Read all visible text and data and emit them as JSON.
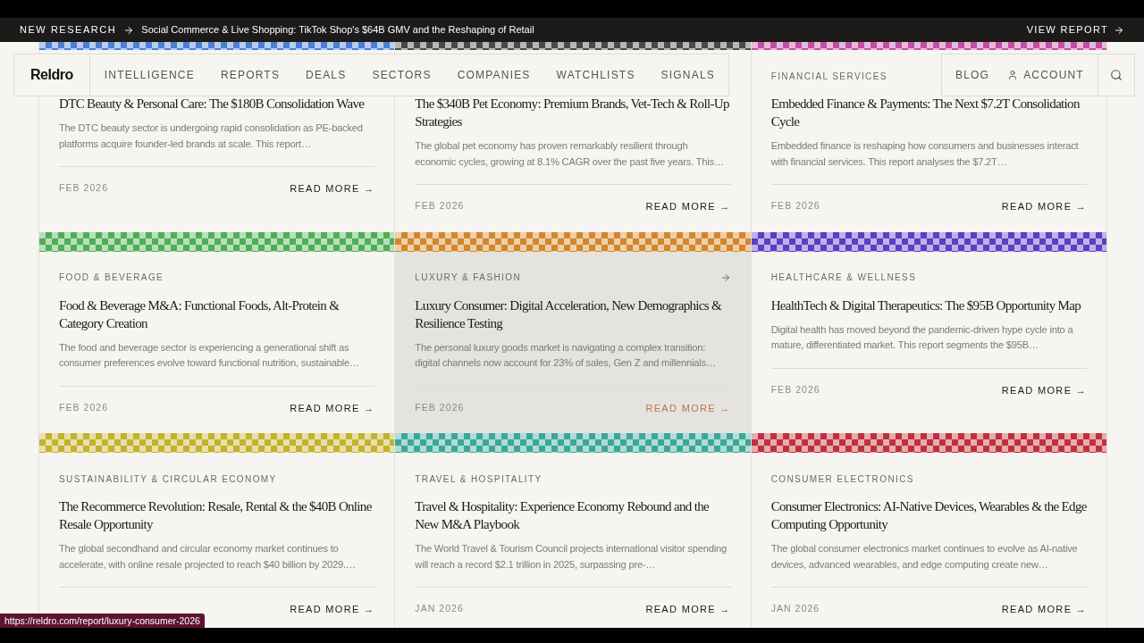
{
  "announcement": {
    "label": "NEW RESEARCH",
    "headline": "Social Commerce & Live Shopping: TikTok Shop's $64B GMV and the Reshaping of Retail",
    "action": "VIEW REPORT"
  },
  "nav": {
    "logo": "Reldro",
    "items": [
      "INTELLIGENCE",
      "REPORTS",
      "DEALS",
      "SECTORS",
      "COMPANIES",
      "WATCHLISTS",
      "SIGNALS"
    ],
    "blog": "BLOG",
    "account": "ACCOUNT"
  },
  "rows": [
    [
      {
        "color": "#4a7fd6",
        "title": "DTC Beauty & Personal Care: The $180B Consolidation Wave",
        "summary": "The DTC beauty sector is undergoing rapid consolidation as PE-backed platforms acquire founder-led brands at scale. This report…",
        "date": "FEB 2026",
        "link": "READ MORE →",
        "hovered": false
      },
      {
        "color": "#4a4a48",
        "title": "The $340B Pet Economy: Premium Brands, Vet-Tech & Roll-Up Strategies",
        "summary": "The global pet economy has proven remarkably resilient through economic cycles, growing at 8.1% CAGR over the past five years. This…",
        "date": "FEB 2026",
        "link": "READ MORE →",
        "hovered": false
      },
      {
        "color": "#c24fa6",
        "category": "FINANCIAL SERVICES",
        "title": "Embedded Finance & Payments: The Next $7.2T Consolidation Cycle",
        "summary": "Embedded finance is reshaping how consumers and businesses interact with financial services. This report analyses the $7.2T…",
        "date": "FEB 2026",
        "link": "READ MORE →",
        "hovered": false
      }
    ],
    [
      {
        "color": "#4fae55",
        "category": "FOOD & BEVERAGE",
        "title": "Food & Beverage M&A: Functional Foods, Alt-Protein & Category Creation",
        "summary": "The food and beverage sector is experiencing a generational shift as consumer preferences evolve toward functional nutrition, sustainable…",
        "date": "FEB 2026",
        "link": "READ MORE →",
        "hovered": false
      },
      {
        "color": "#d4862c",
        "category": "LUXURY & FASHION",
        "title": "Luxury Consumer: Digital Acceleration, New Demographics & Resilience Testing",
        "summary": "The personal luxury goods market is navigating a complex transition: digital channels now account for 23% of sales, Gen Z and millennials…",
        "date": "FEB 2026",
        "link": "READ MORE →",
        "hovered": true
      },
      {
        "color": "#5b3fc4",
        "category": "HEALTHCARE & WELLNESS",
        "title": "HealthTech & Digital Therapeutics: The $95B Opportunity Map",
        "summary": "Digital health has moved beyond the pandemic-driven hype cycle into a mature, differentiated market. This report segments the $95B…",
        "date": "FEB 2026",
        "link": "READ MORE →",
        "hovered": false
      }
    ],
    [
      {
        "color": "#c2b22c",
        "category": "SUSTAINABILITY & CIRCULAR ECONOMY",
        "title": "The Recommerce Revolution: Resale, Rental & the $40B Online Resale Opportunity",
        "summary": "The global secondhand and circular economy market continues to accelerate, with online resale projected to reach $40 billion by 2029.…",
        "link": "READ MORE →",
        "hovered": false
      },
      {
        "color": "#3aa898",
        "category": "TRAVEL & HOSPITALITY",
        "title": "Travel & Hospitality: Experience Economy Rebound and the New M&A Playbook",
        "summary": "The World Travel & Tourism Council projects international visitor spending will reach a record $2.1 trillion in 2025, surpassing pre-…",
        "date": "JAN 2026",
        "link": "READ MORE →",
        "hovered": false
      },
      {
        "color": "#c0303c",
        "category": "CONSUMER ELECTRONICS",
        "title": "Consumer Electronics: AI-Native Devices, Wearables & the Edge Computing Opportunity",
        "summary": "The global consumer electronics market continues to evolve as AI-native devices, advanced wearables, and edge computing create new…",
        "date": "JAN 2026",
        "link": "READ MORE →",
        "hovered": false
      }
    ]
  ],
  "status_url": "https://reldro.com/report/luxury-consumer-2026"
}
